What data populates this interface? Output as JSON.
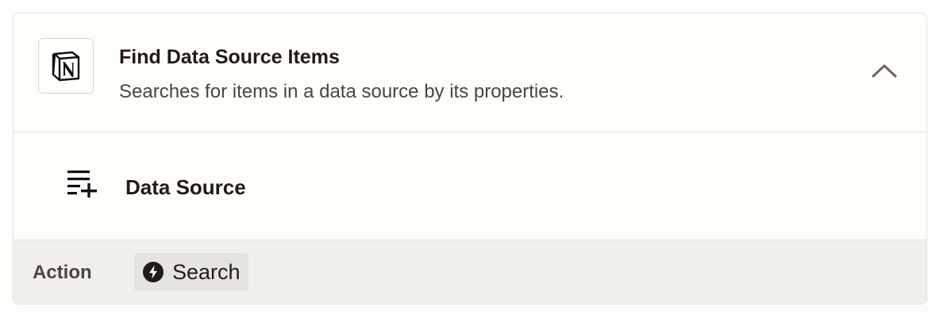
{
  "step": {
    "app_icon": "notion-icon",
    "title": "Find Data Source Items",
    "subtitle": "Searches for items in a data source by its properties.",
    "collapse_icon": "chevron-up-icon"
  },
  "field": {
    "icon": "list-add-icon",
    "label": "Data Source"
  },
  "footer": {
    "label": "Action",
    "chip": {
      "icon": "lightning-bolt-icon",
      "label": "Search"
    }
  },
  "colors": {
    "text_primary": "#201b16",
    "text_secondary": "#4a4540",
    "border": "#e3e1dc",
    "footer_bg": "#f1efe9",
    "chip_bg": "#e6e4de"
  }
}
